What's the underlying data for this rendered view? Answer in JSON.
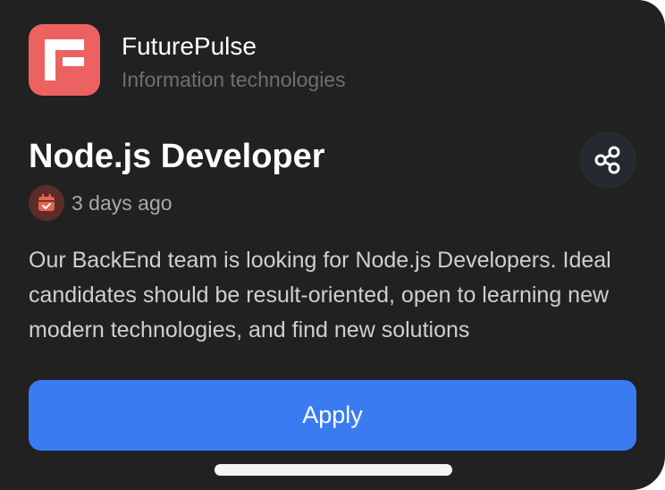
{
  "company": {
    "name": "FuturePulse",
    "sector": "Information technologies",
    "logo_icon": "futurepulse-logo",
    "logo_color": "#ec6260"
  },
  "job": {
    "title": "Node.js Developer",
    "posted": "3 days ago",
    "description": "Our BackEnd team is looking for Node.js Developers. Ideal candidates should be result-oriented, open to learning new modern technologies, and find new solutions"
  },
  "icons": {
    "share": "share-icon",
    "date": "calendar-check-icon"
  },
  "actions": {
    "apply_label": "Apply"
  },
  "colors": {
    "background": "#212121",
    "accent": "#3b7bf2",
    "muted_text": "#6f6f72"
  }
}
